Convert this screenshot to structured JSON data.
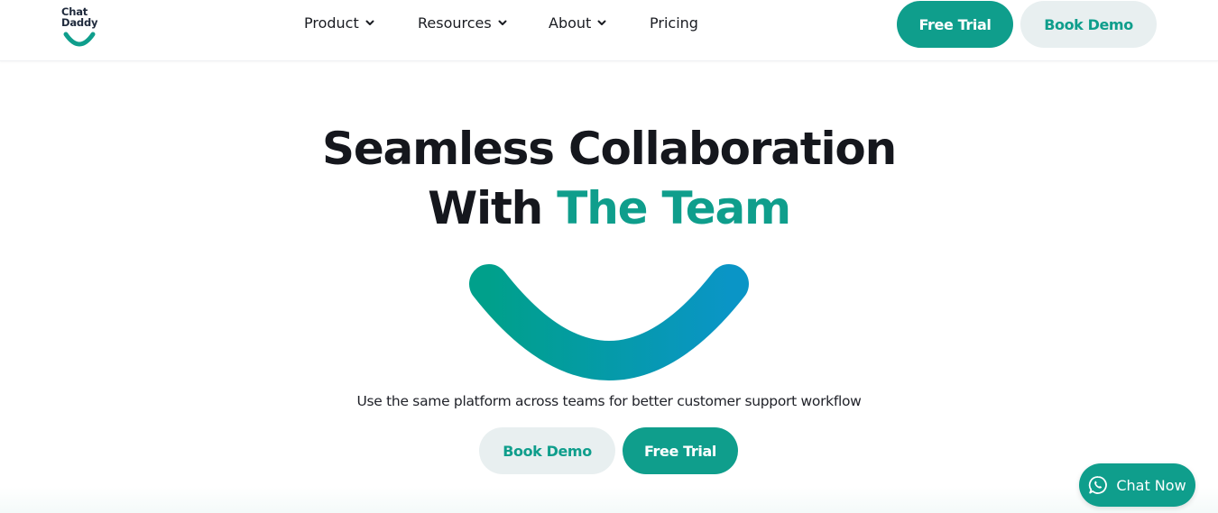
{
  "brand": {
    "logo_line1": "Chat",
    "logo_line2": "Daddy",
    "accent_color": "#0f9e8c",
    "logo_smile_color": "#0f9e8c"
  },
  "nav": {
    "items": [
      {
        "label": "Product",
        "has_dropdown": true,
        "icon": "chevron-down-icon"
      },
      {
        "label": "Resources",
        "has_dropdown": true,
        "icon": "chevron-down-icon"
      },
      {
        "label": "About",
        "has_dropdown": true,
        "icon": "chevron-down-icon"
      },
      {
        "label": "Pricing",
        "has_dropdown": false
      }
    ],
    "free_trial_label": "Free Trial",
    "book_demo_label": "Book Demo"
  },
  "hero": {
    "title_line1": "Seamless Collaboration",
    "title_line2_plain": "With ",
    "title_line2_accent": "The Team",
    "smile_gradient": [
      "#00a08b",
      "#0a95c6"
    ],
    "subtitle": "Use the same platform across teams for better customer support workflow",
    "book_demo_label": "Book Demo",
    "free_trial_label": "Free Trial"
  },
  "chat_widget": {
    "label": "Chat Now",
    "icon": "whatsapp-icon",
    "color": "#0f9e8c"
  }
}
